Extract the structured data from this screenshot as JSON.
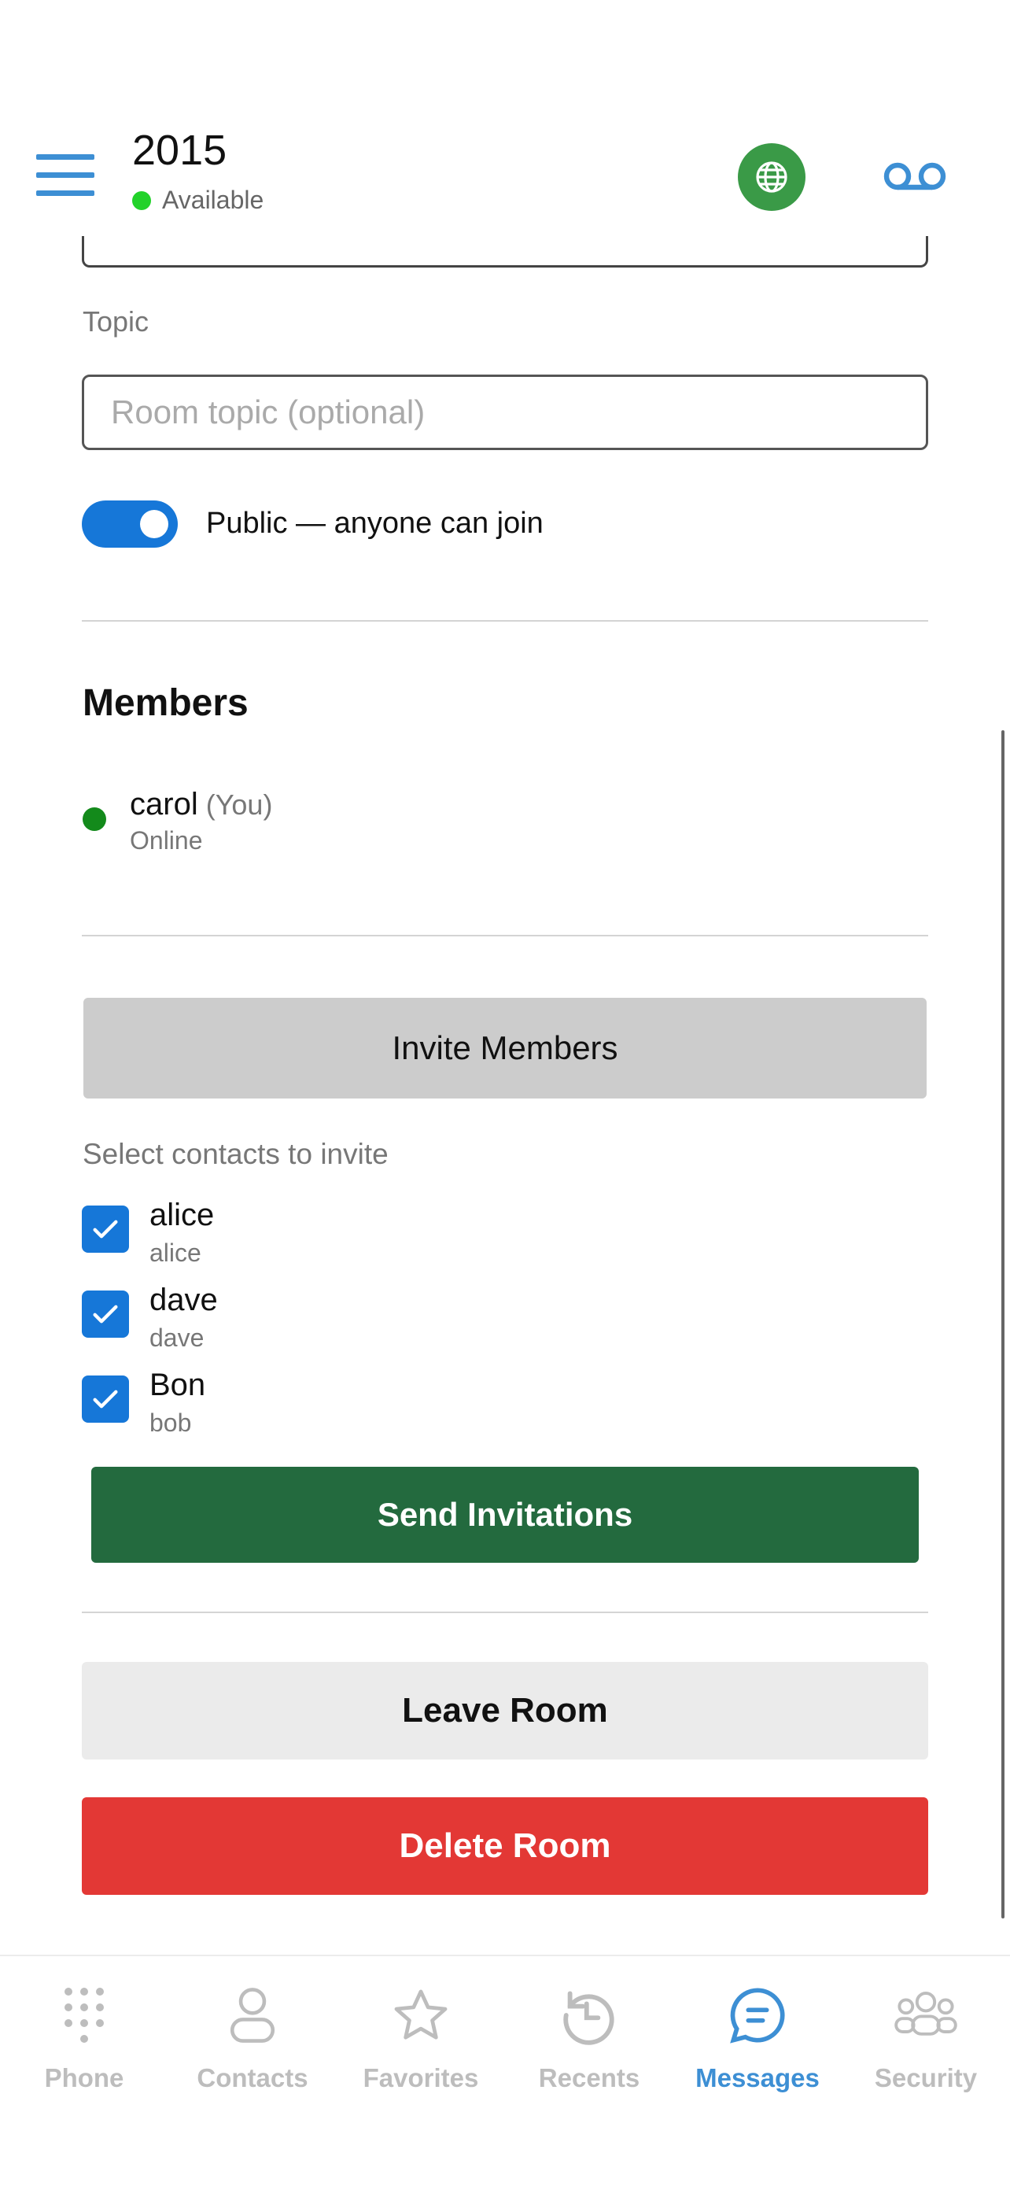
{
  "header": {
    "title": "2015",
    "status": "Available",
    "colors": {
      "accent": "#3d8fd4",
      "status_dot": "#22d22a",
      "globe_bg": "#3a9a47"
    },
    "icons": [
      "menu-icon",
      "globe-icon",
      "voicemail-icon"
    ]
  },
  "form": {
    "topic_label": "Topic",
    "topic_value": "",
    "topic_placeholder": "Room topic (optional)",
    "public_toggle_on": true,
    "public_label": "Public — anyone can join"
  },
  "members": {
    "title": "Members",
    "items": [
      {
        "name": "carol",
        "tag": "(You)",
        "status": "Online",
        "status_color": "#138a1b"
      }
    ]
  },
  "invite": {
    "button_label": "Invite Members",
    "select_label": "Select contacts to invite",
    "contacts": [
      {
        "name": "alice",
        "username": "alice",
        "checked": true
      },
      {
        "name": "dave",
        "username": "dave",
        "checked": true
      },
      {
        "name": "Bon",
        "username": "bob",
        "checked": true
      }
    ],
    "send_label": "Send Invitations"
  },
  "actions": {
    "leave_label": "Leave Room",
    "delete_label": "Delete Room",
    "colors": {
      "send": "#236a3e",
      "delete": "#e33835",
      "leave": "#ebebeb"
    }
  },
  "nav": {
    "active": "Messages",
    "items": [
      {
        "label": "Phone",
        "icon": "dialpad-icon"
      },
      {
        "label": "Contacts",
        "icon": "person-icon"
      },
      {
        "label": "Favorites",
        "icon": "star-icon"
      },
      {
        "label": "Recents",
        "icon": "history-icon"
      },
      {
        "label": "Messages",
        "icon": "chat-bubble-icon"
      },
      {
        "label": "Security",
        "icon": "group-icon"
      }
    ]
  }
}
